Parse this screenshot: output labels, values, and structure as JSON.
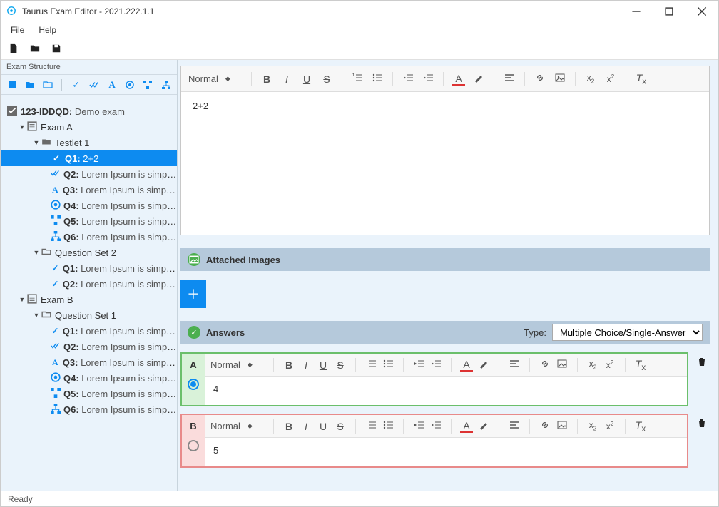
{
  "window": {
    "title": "Taurus Exam Editor - 2021.222.1.1"
  },
  "menu": {
    "file": "File",
    "help": "Help"
  },
  "sidebar": {
    "header": "Exam Structure",
    "root": {
      "label": "123-IDDQD:",
      "sub": "Demo exam"
    },
    "examA": {
      "label": "Exam A",
      "testlet1": {
        "label": "Testlet 1",
        "q1": {
          "id": "Q1:",
          "text": "2+2"
        },
        "q2": {
          "id": "Q2:",
          "text": "Lorem Ipsum is simply dummy"
        },
        "q3": {
          "id": "Q3:",
          "text": "Lorem Ipsum is simply dummy"
        },
        "q4": {
          "id": "Q4:",
          "text": "Lorem Ipsum is simply dummy"
        },
        "q5": {
          "id": "Q5:",
          "text": "Lorem Ipsum is simply dummy"
        },
        "q6": {
          "id": "Q6:",
          "text": "Lorem Ipsum is simply dummy"
        }
      },
      "qset2": {
        "label": "Question Set 2",
        "q1": {
          "id": "Q1:",
          "text": "Lorem Ipsum is simply dummy"
        },
        "q2": {
          "id": "Q2:",
          "text": "Lorem Ipsum is simply dummy"
        }
      }
    },
    "examB": {
      "label": "Exam B",
      "qset1": {
        "label": "Question Set 1",
        "q1": {
          "id": "Q1:",
          "text": "Lorem Ipsum is simply dummy"
        },
        "q2": {
          "id": "Q2:",
          "text": "Lorem Ipsum is simply dummy"
        },
        "q3": {
          "id": "Q3:",
          "text": "Lorem Ipsum is simply dummy"
        },
        "q4": {
          "id": "Q4:",
          "text": "Lorem Ipsum is simply dummy"
        },
        "q5": {
          "id": "Q5:",
          "text": "Lorem Ipsum is simply dummy"
        },
        "q6": {
          "id": "Q6:",
          "text": "Lorem Ipsum is simply dummy"
        }
      }
    }
  },
  "editor": {
    "style_label": "Normal",
    "question_text": "2+2",
    "attached_header": "Attached Images",
    "answers_header": "Answers",
    "type_label": "Type:",
    "type_value": "Multiple Choice/Single-Answer",
    "answerA": {
      "letter": "A",
      "text": "4"
    },
    "answerB": {
      "letter": "B",
      "text": "5"
    }
  },
  "status": "Ready"
}
